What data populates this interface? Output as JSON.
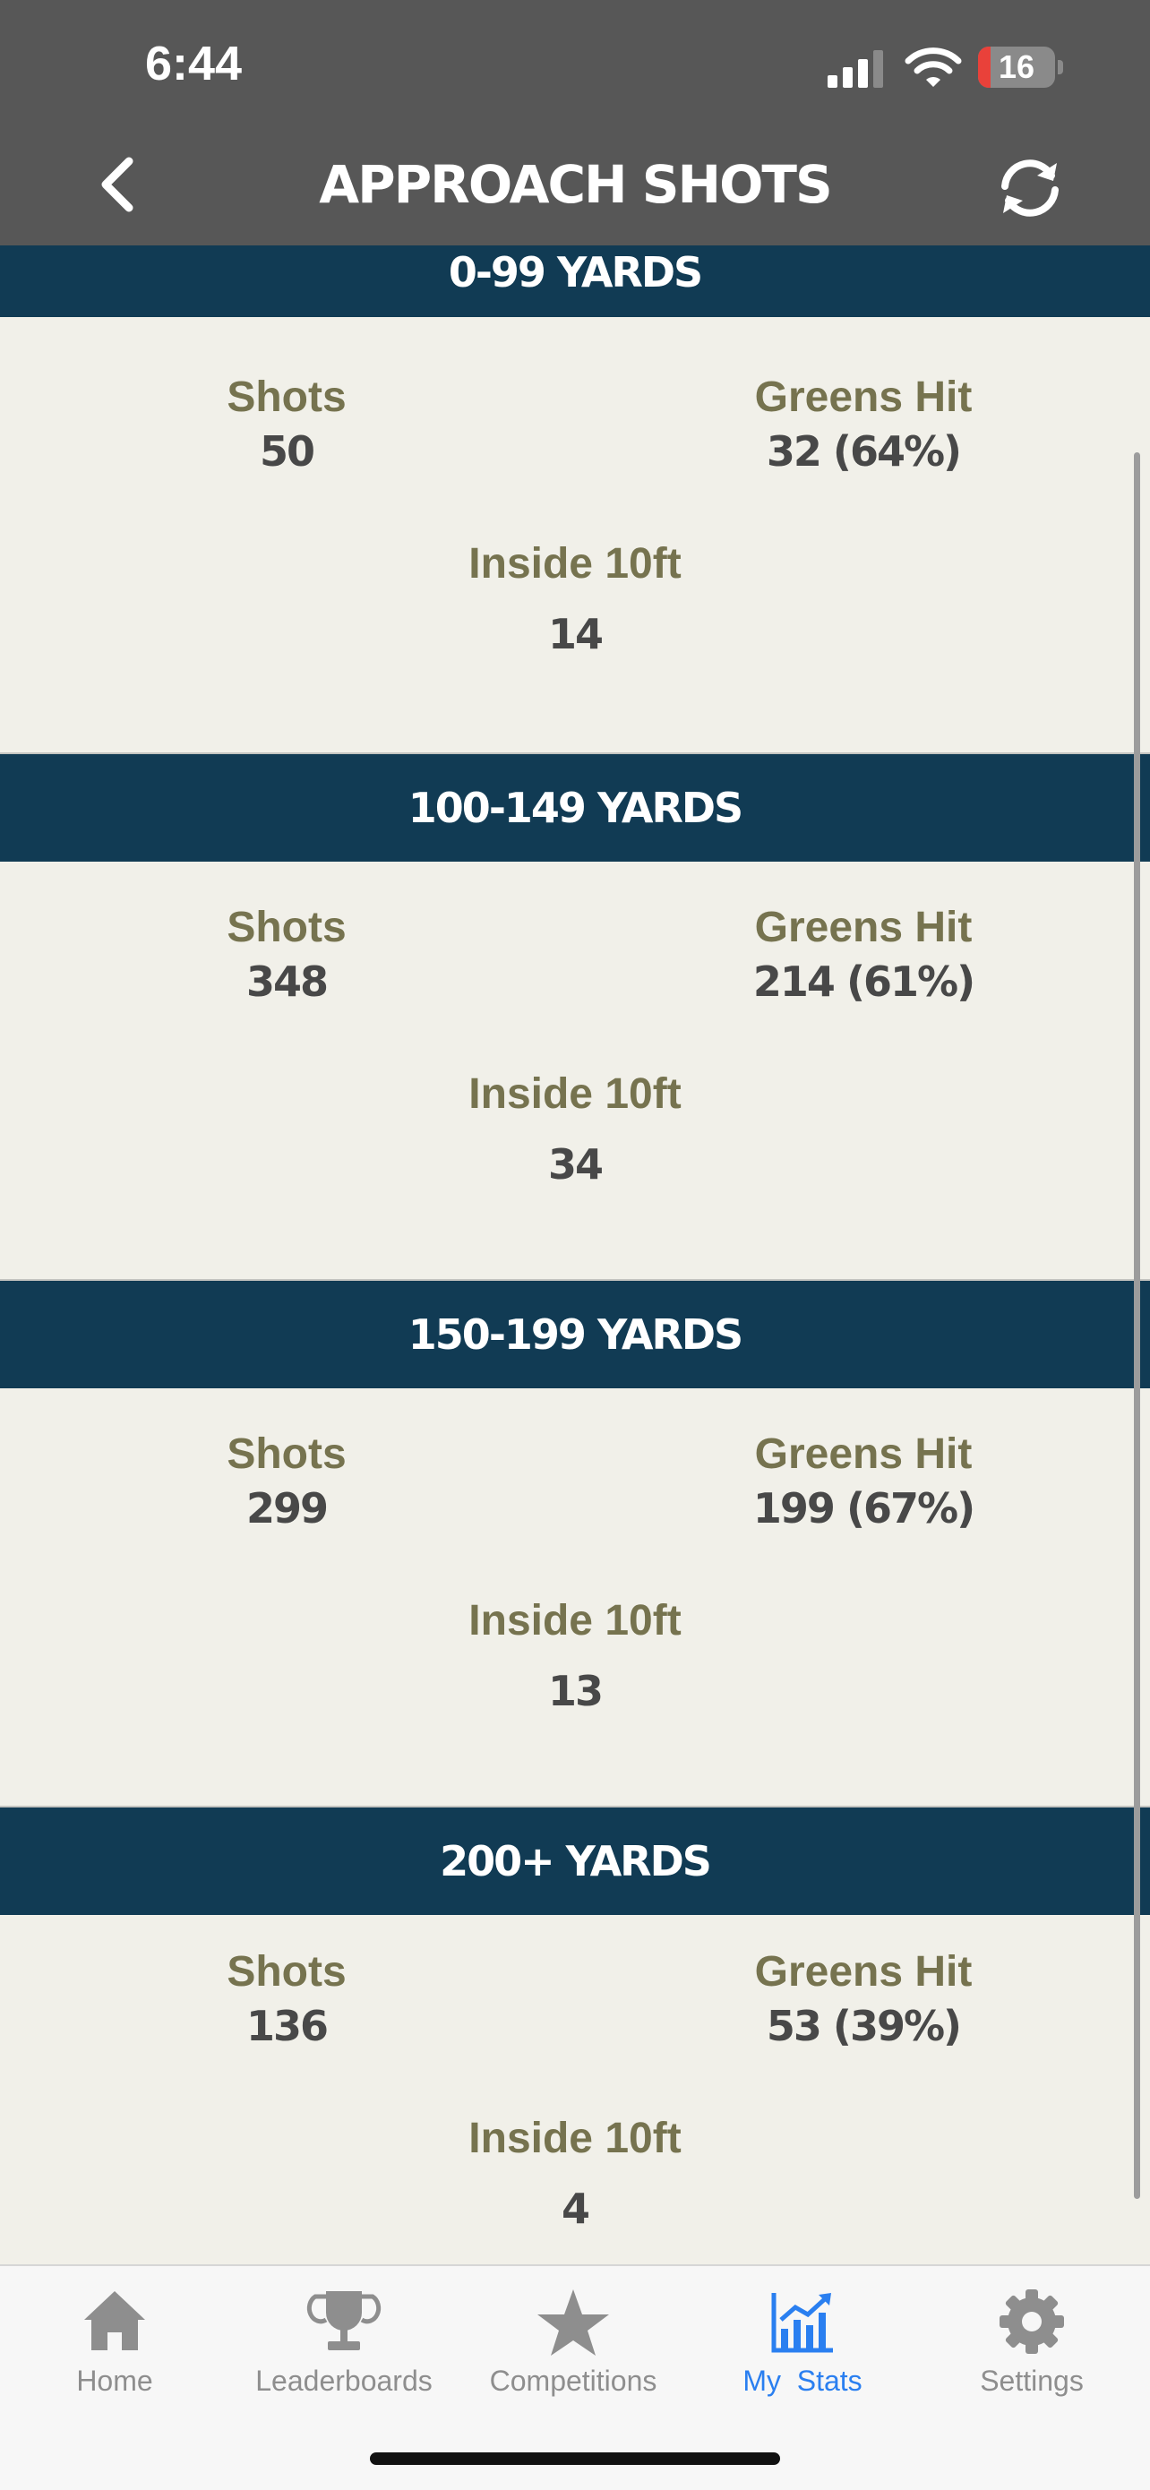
{
  "status_bar": {
    "time": "6:44",
    "battery_level": "16",
    "battery_fraction": 0.16,
    "battery_color": "#e9413a"
  },
  "nav": {
    "title": "APPROACH SHOTS",
    "back_icon": "chevron-left-icon",
    "refresh_icon": "refresh-icon"
  },
  "sections": [
    {
      "title": "0-99 YARDS",
      "shots_label": "Shots",
      "shots": "50",
      "greens_label": "Greens Hit",
      "greens": "32 (64%)",
      "inside_label": "Inside 10ft",
      "inside": "14"
    },
    {
      "title": "100-149 YARDS",
      "shots_label": "Shots",
      "shots": "348",
      "greens_label": "Greens Hit",
      "greens": "214 (61%)",
      "inside_label": "Inside 10ft",
      "inside": "34"
    },
    {
      "title": "150-199 YARDS",
      "shots_label": "Shots",
      "shots": "299",
      "greens_label": "Greens Hit",
      "greens": "199 (67%)",
      "inside_label": "Inside 10ft",
      "inside": "13"
    },
    {
      "title": "200+ YARDS",
      "shots_label": "Shots",
      "shots": "136",
      "greens_label": "Greens Hit",
      "greens": "53 (39%)",
      "inside_label": "Inside 10ft",
      "inside": "4"
    }
  ],
  "tabs": [
    {
      "label": "Home",
      "icon": "home-icon",
      "active": false
    },
    {
      "label": "Leaderboards",
      "icon": "trophy-icon",
      "active": false
    },
    {
      "label": "Competitions",
      "icon": "star-icon",
      "active": false
    },
    {
      "label": "My  Stats",
      "icon": "chart-icon",
      "active": true
    },
    {
      "label": "Settings",
      "icon": "gear-icon",
      "active": false
    }
  ],
  "colors": {
    "header_bar": "#575757",
    "section_header": "#113b54",
    "label": "#76734f",
    "value": "#484848",
    "active_tab": "#2a7ff0",
    "inactive_tab": "#8e8e8e"
  }
}
